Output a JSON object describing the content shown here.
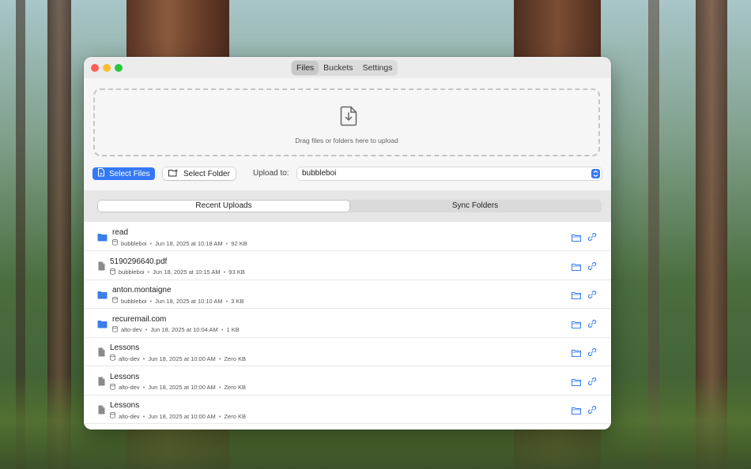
{
  "window": {
    "tabs": [
      {
        "label": "Files",
        "active": true
      },
      {
        "label": "Buckets",
        "active": false
      },
      {
        "label": "Settings",
        "active": false
      }
    ]
  },
  "dropzone": {
    "text": "Drag files or folders here to upload"
  },
  "toolbar": {
    "select_files_label": "Select Files",
    "select_folder_label": "Select Folder",
    "upload_to_label": "Upload to:",
    "upload_to_value": "bubbleboi"
  },
  "segments": [
    {
      "label": "Recent Uploads",
      "active": true
    },
    {
      "label": "Sync Folders",
      "active": false
    }
  ],
  "uploads": [
    {
      "type": "folder",
      "name": "read",
      "bucket": "bubbleboi",
      "date": "Jun 18, 2025 at 10:18 AM",
      "size": "92 KB"
    },
    {
      "type": "file",
      "name": "5190296640.pdf",
      "bucket": "bubbleboi",
      "date": "Jun 18, 2025 at 10:15 AM",
      "size": "93 KB"
    },
    {
      "type": "folder",
      "name": "anton.montaigne",
      "bucket": "bubbleboi",
      "date": "Jun 18, 2025 at 10:10 AM",
      "size": "3 KB"
    },
    {
      "type": "folder",
      "name": "recuremail.com",
      "bucket": "alto-dev",
      "date": "Jun 18, 2025 at 10:04 AM",
      "size": "1 KB"
    },
    {
      "type": "file",
      "name": "Lessons",
      "bucket": "alto-dev",
      "date": "Jun 18, 2025 at 10:00 AM",
      "size": "Zero KB"
    },
    {
      "type": "file",
      "name": "Lessons",
      "bucket": "alto-dev",
      "date": "Jun 18, 2025 at 10:00 AM",
      "size": "Zero KB"
    },
    {
      "type": "file",
      "name": "Lessons",
      "bucket": "alto-dev",
      "date": "Jun 18, 2025 at 10:00 AM",
      "size": "Zero KB"
    }
  ],
  "colors": {
    "accent": "#3478f6",
    "folder": "#3a7ee8"
  }
}
